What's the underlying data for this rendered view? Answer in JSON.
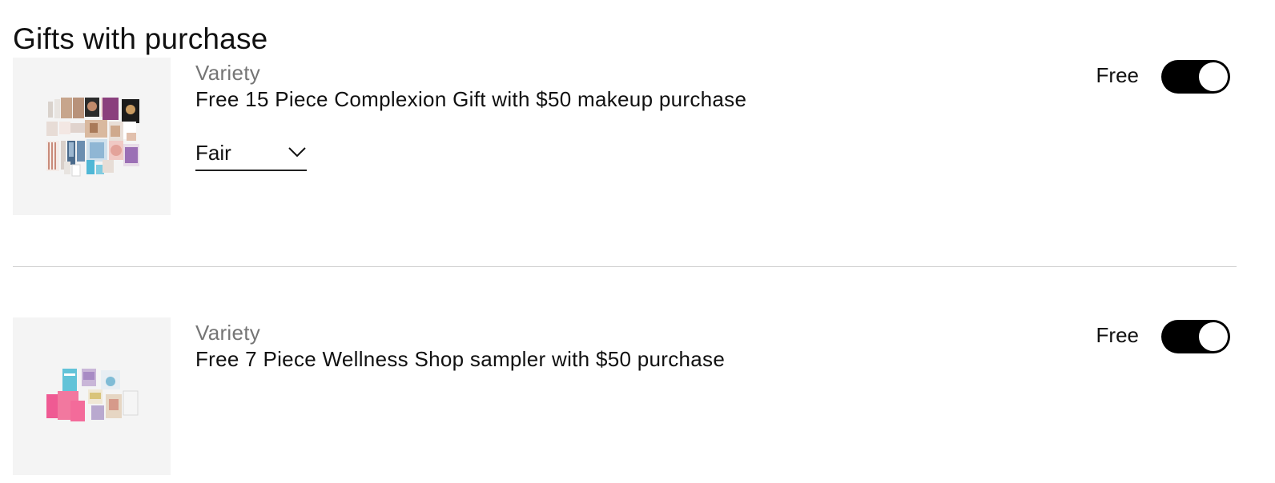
{
  "section": {
    "title": "Gifts with purchase"
  },
  "items": [
    {
      "brand": "Variety",
      "name": "Free 15 Piece Complexion Gift with $50 makeup purchase",
      "shade_selected": "Fair",
      "price": "Free",
      "toggle_on": true,
      "image_icon": "complexion-gift-collage"
    },
    {
      "brand": "Variety",
      "name": "Free 7 Piece Wellness Shop sampler with $50 purchase",
      "price": "Free",
      "toggle_on": true,
      "image_icon": "wellness-sampler-collage"
    }
  ],
  "colors": {
    "toggle_on": "#000000",
    "divider": "#cfcfcf",
    "brand_text": "#757575",
    "thumb_bg": "#f4f4f4"
  }
}
